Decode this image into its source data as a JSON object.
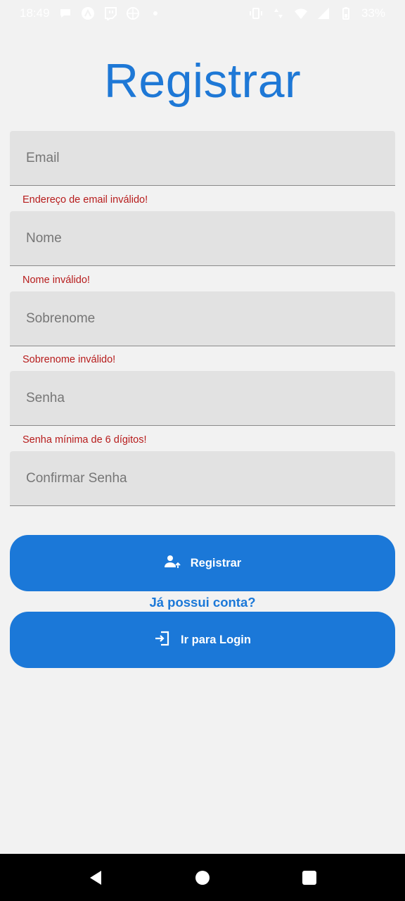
{
  "status_bar": {
    "time": "18:49",
    "battery": "33%",
    "left_icons": [
      "chat-icon",
      "android-icon",
      "twitch-icon",
      "globe-icon",
      "dot-icon"
    ],
    "right_icons": [
      "vibrate-icon",
      "data-icon",
      "wifi-icon",
      "signal-icon",
      "battery-icon"
    ]
  },
  "page": {
    "title": "Registrar"
  },
  "form": {
    "email": {
      "placeholder": "Email",
      "value": "",
      "error": "Endereço de email inválido!"
    },
    "nome": {
      "placeholder": "Nome",
      "value": "",
      "error": "Nome inválido!"
    },
    "sobrenome": {
      "placeholder": "Sobrenome",
      "value": "",
      "error": "Sobrenome inválido!"
    },
    "senha": {
      "placeholder": "Senha",
      "value": "",
      "error": "Senha mínima de 6 dígitos!"
    },
    "confirmar": {
      "placeholder": "Confirmar Senha",
      "value": ""
    }
  },
  "buttons": {
    "register_label": "Registrar",
    "register_icon": "person-add-icon",
    "already_account": "Já possui conta?",
    "login_label": "Ir para Login",
    "login_icon": "login-icon"
  },
  "nav": {
    "icons": [
      "back-icon",
      "home-icon",
      "recents-icon"
    ]
  },
  "colors": {
    "primary": "#1b78d8",
    "title": "#1e78d6",
    "error": "#b71c1c",
    "background": "#f2f2f2",
    "field": "#e2e2e2"
  }
}
